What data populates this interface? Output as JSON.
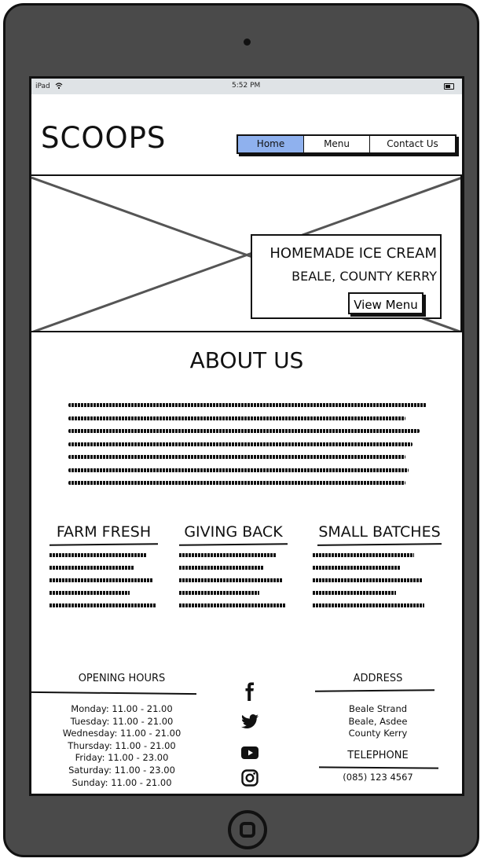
{
  "status": {
    "device": "iPad",
    "time": "5:52 PM"
  },
  "site": {
    "logo": "SCOOPS"
  },
  "nav": {
    "items": [
      "Home",
      "Menu",
      "Contact Us"
    ],
    "active": "Home",
    "active_color": "#8fb1ee"
  },
  "hero": {
    "title": "HOMEMADE ICE CREAM",
    "subtitle": "BEALE, COUNTY KERRY",
    "button": "View Menu"
  },
  "about": {
    "title": "ABOUT US"
  },
  "features": [
    {
      "title": "FARM FRESH"
    },
    {
      "title": "GIVING BACK"
    },
    {
      "title": "SMALL BATCHES"
    }
  ],
  "footer": {
    "hours_title": "OPENING HOURS",
    "hours": [
      "Monday: 11.00 - 21.00",
      "Tuesday: 11.00 - 21.00",
      "Wednesday: 11.00 - 21.00",
      "Thursday: 11.00 - 21.00",
      "Friday: 11.00 - 23.00",
      "Saturday: 11.00 - 23.00",
      "Sunday: 11.00 - 21.00"
    ],
    "address_title": "ADDRESS",
    "address": [
      "Beale Strand",
      "Beale, Asdee",
      "County Kerry"
    ],
    "telephone_title": "TELEPHONE",
    "telephone": "(085) 123 4567",
    "social_icons": [
      "facebook-icon",
      "twitter-icon",
      "youtube-icon",
      "instagram-icon"
    ]
  },
  "colors": {
    "device_frame": "#4a4a4a",
    "status_bar": "#dfe3e6",
    "ink": "#111111"
  }
}
